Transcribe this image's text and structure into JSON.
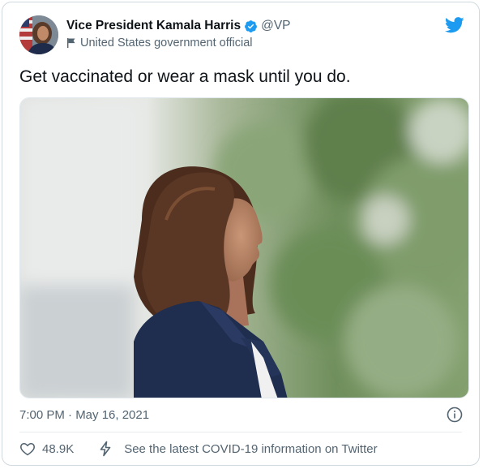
{
  "author": {
    "display_name": "Vice President Kamala Harris",
    "handle": "@VP",
    "label": "United States government official",
    "avatar_icon": "avatar-photo",
    "verified_icon": "verified-badge-icon",
    "verified_color": "#1d9bf0"
  },
  "tweet": {
    "text": "Get vaccinated or wear a mask until you do.",
    "timestamp": "7:00 PM · May 16, 2021"
  },
  "footer": {
    "likes": "48.9K",
    "covid_link": "See the latest COVID-19 information on Twitter"
  },
  "icons": {
    "brand": "twitter-bird-icon",
    "info": "info-icon",
    "like": "heart-icon",
    "covid": "lightning-bolt-icon",
    "label": "flag-icon"
  },
  "colors": {
    "brand": "#1d9bf0",
    "text_primary": "#0f1419",
    "text_secondary": "#536471",
    "border": "#cfd9de"
  }
}
